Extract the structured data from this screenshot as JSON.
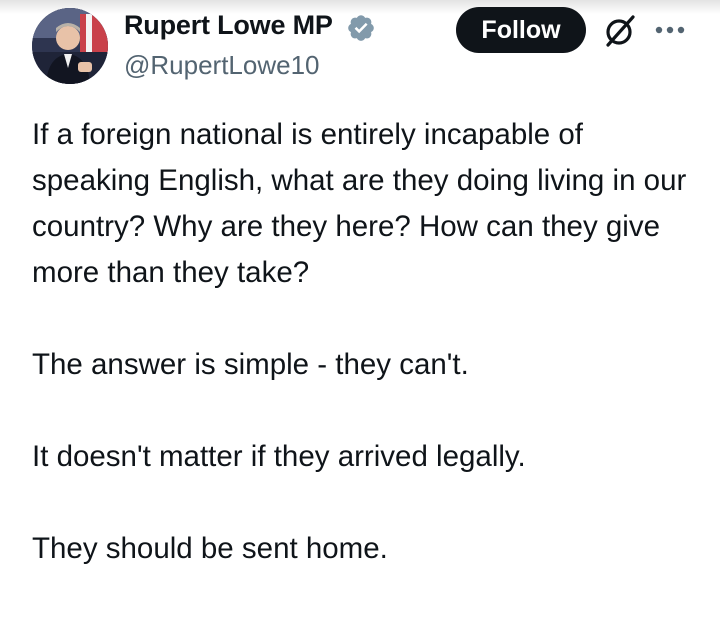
{
  "author": {
    "display_name": "Rupert Lowe MP",
    "handle": "@RupertLowe10",
    "verified": true,
    "avatar_icon": "avatar-photo"
  },
  "actions": {
    "follow_label": "Follow",
    "grok_icon": "grok-icon",
    "more_icon": "more-horizontal-icon"
  },
  "tweet": {
    "paragraphs": [
      "If a foreign national is entirely incapable of speaking English, what are they doing living in our country? Why are they here? How can they give more than they take?",
      "The answer is simple - they can't.",
      "It doesn't matter if they arrived legally.",
      "They should be sent home."
    ]
  },
  "colors": {
    "text": "#0f1419",
    "secondary_text": "#536471",
    "follow_bg": "#0f1419",
    "follow_text": "#ffffff",
    "verified_badge": "#829aab"
  }
}
